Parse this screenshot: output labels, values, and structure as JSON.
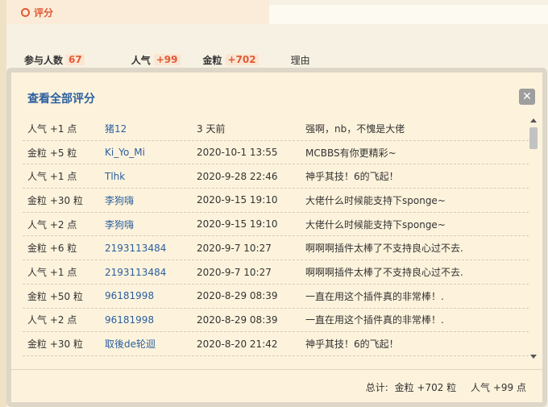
{
  "header": {
    "title": "评分"
  },
  "stats": {
    "participants_label": "参与人数",
    "participants_value": "67",
    "popularity_label": "人气",
    "popularity_value": "+99",
    "gold_label": "金粒",
    "gold_value": "+702",
    "reason_label": "理由"
  },
  "dialog": {
    "title": "查看全部评分",
    "close_symbol": "✕",
    "rows": [
      {
        "score": "人气 +1 点",
        "user": "猪12",
        "time": "3 天前",
        "reason": "强啊，nb，不愧是大佬"
      },
      {
        "score": "金粒 +5 粒",
        "user": "Ki_Yo_Mi",
        "time": "2020-10-1 13:55",
        "reason": "MCBBS有你更精彩~"
      },
      {
        "score": "人气 +1 点",
        "user": "Tlhk",
        "time": "2020-9-28 22:46",
        "reason": "神乎其技！6的飞起！"
      },
      {
        "score": "金粒 +30 粒",
        "user": "李狗嗨",
        "time": "2020-9-15 19:10",
        "reason": "大佬什么时候能支持下sponge~"
      },
      {
        "score": "人气 +2 点",
        "user": "李狗嗨",
        "time": "2020-9-15 19:10",
        "reason": "大佬什么时候能支持下sponge~"
      },
      {
        "score": "金粒 +6 粒",
        "user": "2193113484",
        "time": "2020-9-7 10:27",
        "reason": "啊啊啊插件太棒了不支持良心过不去."
      },
      {
        "score": "人气 +1 点",
        "user": "2193113484",
        "time": "2020-9-7 10:27",
        "reason": "啊啊啊插件太棒了不支持良心过不去."
      },
      {
        "score": "金粒 +50 粒",
        "user": "96181998",
        "time": "2020-8-29 08:39",
        "reason": "一直在用这个插件真的非常棒！."
      },
      {
        "score": "人气 +2 点",
        "user": "96181998",
        "time": "2020-8-29 08:39",
        "reason": "一直在用这个插件真的非常棒！."
      },
      {
        "score": "金粒 +30 粒",
        "user": "取後de轮迴",
        "time": "2020-8-20 21:42",
        "reason": "神乎其技！6的飞起！"
      }
    ],
    "summary": {
      "total_label": "总计:",
      "gold_total": "金粒 +702 粒",
      "pop_total": "人气 +99 点"
    }
  }
}
